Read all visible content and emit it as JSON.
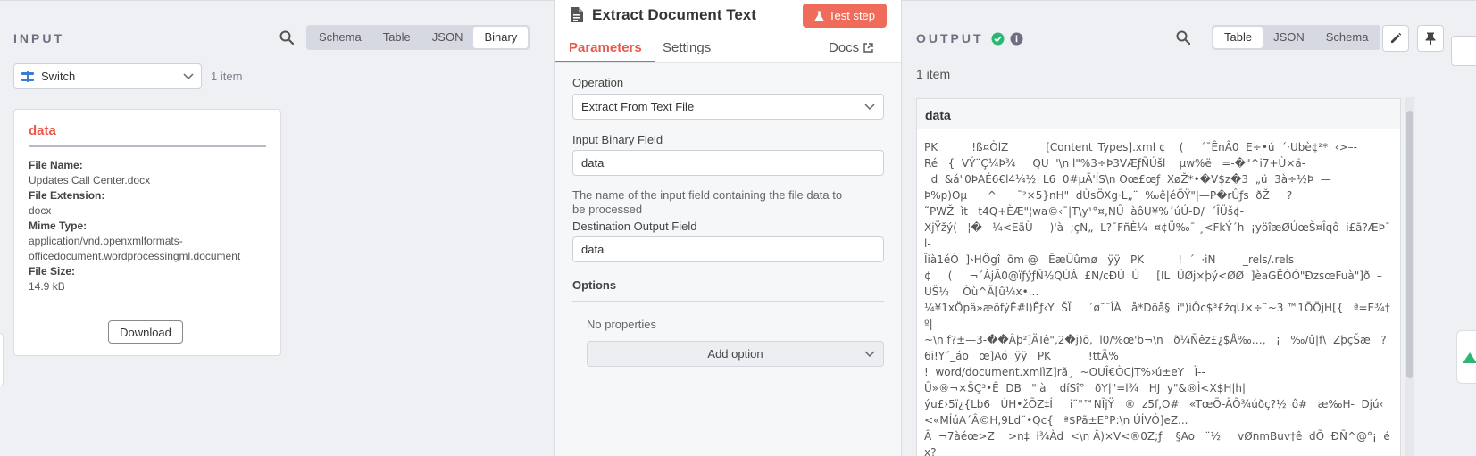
{
  "input": {
    "title": "INPUT",
    "views": [
      "Schema",
      "Table",
      "JSON",
      "Binary"
    ],
    "active_view": "Binary",
    "source_node": "Switch",
    "item_count": "1 item",
    "card": {
      "title": "data",
      "file_name_label": "File Name:",
      "file_name": "Updates Call Center.docx",
      "file_ext_label": "File Extension:",
      "file_ext": "docx",
      "mime_label": "Mime Type:",
      "mime_line1": "application/vnd.openxmlformats-",
      "mime_line2": "officedocument.wordprocessingml.document",
      "size_label": "File Size:",
      "size": "14.9 kB",
      "download_label": "Download"
    }
  },
  "node": {
    "title": "Extract Document Text",
    "test_label": "Test step",
    "tabs": [
      "Parameters",
      "Settings"
    ],
    "docs_label": "Docs",
    "operation_label": "Operation",
    "operation_value": "Extract From Text File",
    "binary_field_label": "Input Binary Field",
    "binary_field_value": "data",
    "binary_field_hint": "The name of the input field containing the file data to be processed",
    "dest_field_label": "Destination Output Field",
    "dest_field_value": "data",
    "options_label": "Options",
    "no_properties": "No properties",
    "add_option_label": "Add option"
  },
  "output": {
    "title": "OUTPUT",
    "views": [
      "Table",
      "JSON",
      "Schema"
    ],
    "active_view": "Table",
    "item_count": "1 item",
    "column": "data",
    "text": "PK          !ß¤ÒlZ           [Content_Types].xml ¢    (     ´¯ÊnÂ0  E÷•ú  ´·Ubè¢²*  ‹>–-\nRé   {  VÝ¨Ç¼Þ¾     QU  '\\n l\"%3÷Þ3VÆƒÑÚšl    µw%ë   =-�\"^i7+Ù×ä-\n  d  &á\"0ÞAÉ6€l4¼½  L6  0#µÃ'ÍS\\n Oœ£œƒ  XøŽ*•�V$z�3  „ü  3à÷½Þ  —\nÞ%p)Oµ      ^      ¯²×5}nH\"  dÙsÖXg·L„¨  ‰ê|éÕŸ\"|—P�rÛƒs  ðŽ     ?\n˜PWŽ  ìt   t4Q+ÈÆ\"¦wa©‹¯|T\\y¹°¤,NÛ  àôU¥%´úÚ-D/  ´ÎÜš¢-\nXjŸžý(   ¦�   ¼<EãÜ     )'à  ;çN„  L?¯FñÈ¼  ¤¢Ü‰¯ ¸<FkÝ´h  ¡yöîæØÚœŠ¤Îqô  i£ã?ÆÞ¯l-\nÎià1éÓ  ]›HÖgî  õm @   ÊæÛûmø   ÿÿ   PK          !  ´  ·iN        _rels/.rels\n¢     (     ¬´ÁjÃ0@ïƒýƒÑ½QÚÁ  £N/cÐÚ  Ù     [IL  ÛØj×þý<ØØ  ]èaGËÒÓ\"ÐzsœFuà\"]ð  –\nUŠ½    Òù^Ã[û¼x•...\n¼¥1xÖpâ»æöfýÊ#l)Êƒ‹Y  ŠÏ     ´ø˜¯ÎÀ   å*Döå§  i\")ìÔc$³£žqU×÷˜~3 ™1ÕÖjH[{   ª=E¾†   º|\n~\\n f?±—3-��Âþ²]ÄTê\"‚2�j)õ,  l0/%œ'b¬\\n   ð¼Ñêz£¿$Å‰…,   ¡   ‰/û|f\\  ZþçŠæ   ?\n6i!Y´_áo   œ]Aó  ÿÿ   PK           !ttÃ%\n!  word/document.xmlìZ]rã¸  ~OUÎ€ÒCjT%›ú±eY   Ï--\nÛ»®¬×ŠÇ³•Ê  DB   \"'à    díSî°   ðY|\"=l¾   HJ  y\"&®Ì<X$H|h|\nýu£›5ï¿{Lb6   ÚH•žÕZ‡Í     i¨\"™NÎjŸ   ®  z5f,O#   «TœÕ-ÂÕ¾úðç?½_ô#   æ‰H-  Djú‹\n<«MÍúA´Â©H,9Ld¨•Qc{   ª$Pã±E°P:\\n ÚÍVÓ]eZ...\nÂ  ¬7àéœ>Z    >n‡  i¾Àd  <\\n Â)×V<®0Z;ƒ    §Ao   ¨½     vØnmBuv†ê  dÕ  ĐÑ^@°¡  éx?"
  },
  "colors": {
    "accent": "#ef6c5a",
    "accent_text": "#e9594c",
    "success": "#2bb673"
  },
  "icons": {
    "search": "search-icon",
    "success": "check-circle-icon",
    "info": "info-icon",
    "edit": "pencil-icon",
    "pin": "pin-icon",
    "external": "external-link-icon",
    "node": "file-text-icon",
    "flask": "flask-icon",
    "switch": "switch-icon",
    "chevron": "chevron-down-icon"
  }
}
